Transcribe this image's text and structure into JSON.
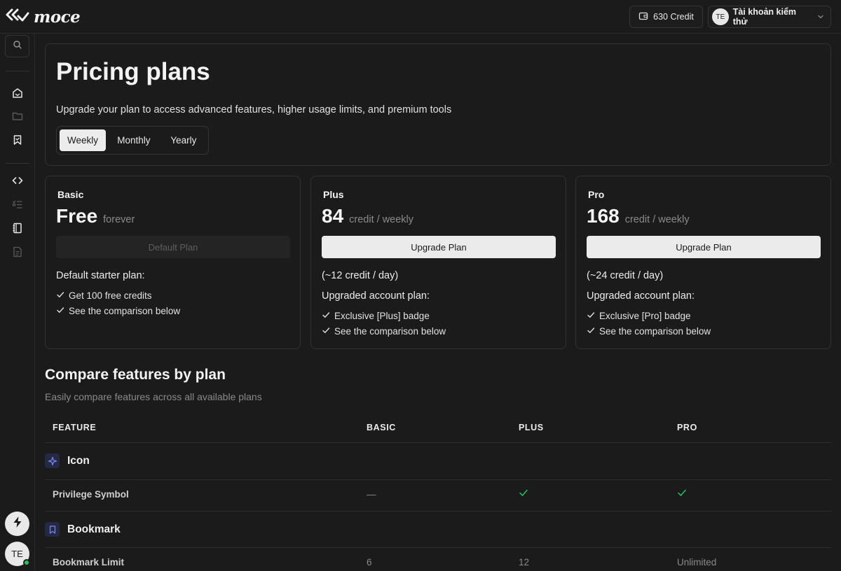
{
  "app": {
    "logo_text": "moce"
  },
  "header": {
    "credit_label": "630 Credit",
    "account_initials": "TE",
    "account_name": "Tài khoản kiểm thử"
  },
  "sidebar": {
    "icons": [
      "search-icon",
      "home-icon",
      "folder-icon",
      "bookmark-icon",
      "code-icon",
      "checklist-icon",
      "notebook-icon",
      "document-icon"
    ],
    "bolt_icon": "bolt-icon",
    "avatar_initials": "TE",
    "status": "online"
  },
  "pricing": {
    "title": "Pricing plans",
    "subtitle": "Upgrade your plan to access advanced features, higher usage limits, and premium tools",
    "periods": [
      "Weekly",
      "Monthly",
      "Yearly"
    ],
    "active_period": "Weekly"
  },
  "plans": [
    {
      "name": "Basic",
      "price": "Free",
      "unit": "forever",
      "button": "Default Plan",
      "button_enabled": false,
      "rate": "",
      "heading": "Default starter plan:",
      "features": [
        "Get 100 free credits",
        "See the comparison below"
      ]
    },
    {
      "name": "Plus",
      "price": "84",
      "unit": "credit / weekly",
      "button": "Upgrade Plan",
      "button_enabled": true,
      "rate": "(~12 credit / day)",
      "heading": "Upgraded account plan:",
      "features": [
        "Exclusive [Plus] badge",
        "See the comparison below"
      ]
    },
    {
      "name": "Pro",
      "price": "168",
      "unit": "credit / weekly",
      "button": "Upgrade Plan",
      "button_enabled": true,
      "rate": "(~24 credit / day)",
      "heading": "Upgraded account plan:",
      "features": [
        "Exclusive [Pro] badge",
        "See the comparison below"
      ]
    }
  ],
  "compare": {
    "title": "Compare features by plan",
    "subtitle": "Easily compare features across all available plans",
    "headers": [
      "FEATURE",
      "BASIC",
      "PLUS",
      "PRO"
    ],
    "sections": [
      {
        "name": "Icon",
        "icon": "sparkle-icon",
        "rows": [
          {
            "feature": "Privilege Symbol",
            "basic": "—",
            "plus": "check",
            "pro": "check"
          }
        ]
      },
      {
        "name": "Bookmark",
        "icon": "bookmark-icon",
        "rows": [
          {
            "feature": "Bookmark Limit",
            "basic": "6",
            "plus": "12",
            "pro": "Unlimited"
          }
        ]
      }
    ]
  },
  "colors": {
    "background": "#1b1b1b",
    "border": "#333333",
    "check": "#22c55e",
    "section_icon_bg": "#252a44",
    "section_icon_fg": "#7c86f0"
  }
}
